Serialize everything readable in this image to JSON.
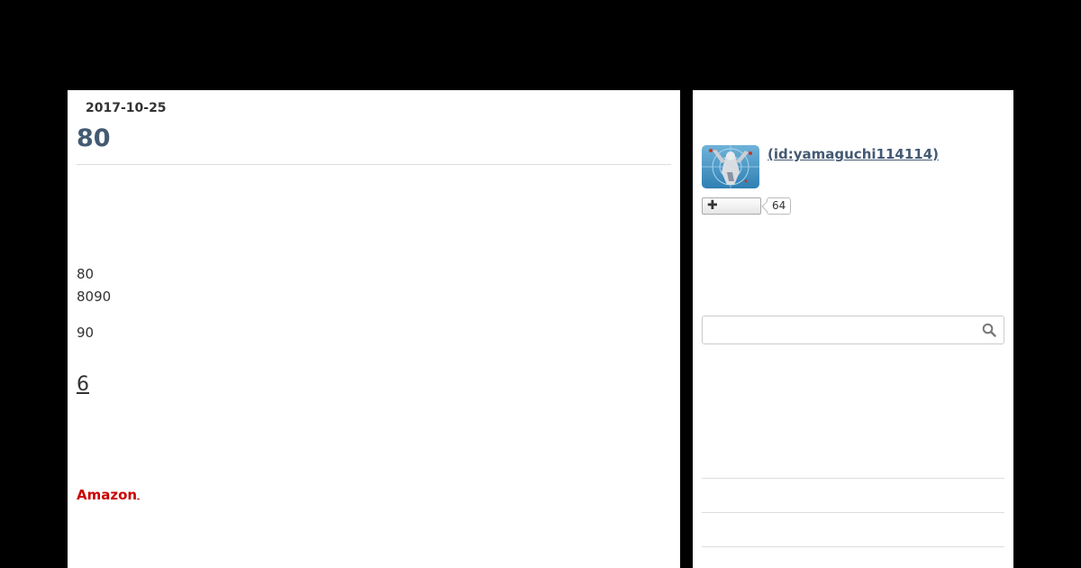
{
  "entry": {
    "date": "2017-10-25",
    "title": "80",
    "body_lines": [
      "80",
      "8090",
      "90"
    ],
    "section_heading": "6",
    "affiliate_link": "Amazon"
  },
  "profile": {
    "name": " (id:yamaguchi114114)",
    "subscriber_count": "64"
  },
  "search": {
    "placeholder": ""
  },
  "colors": {
    "background": "#000000",
    "title": "#435a73",
    "affiliate_link": "#cc0000"
  }
}
